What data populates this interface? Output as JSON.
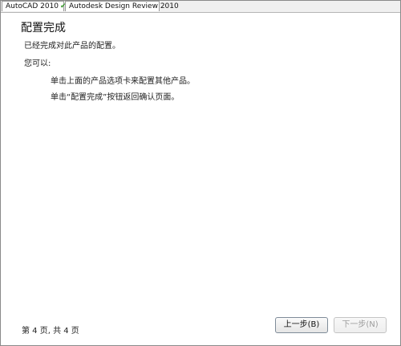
{
  "tabs": [
    {
      "label": "AutoCAD 2010",
      "status_icon": "checkmark-icon"
    },
    {
      "label": "Autodesk Design Review 2010"
    }
  ],
  "header": {
    "title": "配置完成"
  },
  "content": {
    "description": "已经完成对此产品的配置。",
    "you_can": "您可以:",
    "options": [
      "单击上面的产品选项卡来配置其他产品。",
      "单击“配置完成”按钮返回确认页面。"
    ]
  },
  "footer": {
    "page_info": "第 4 页, 共 4 页",
    "prev_label": "上一步(B)",
    "next_label": "下一步(N)"
  },
  "colors": {
    "check": "#3a9b2e",
    "disabled_text": "#9c9c9c"
  }
}
